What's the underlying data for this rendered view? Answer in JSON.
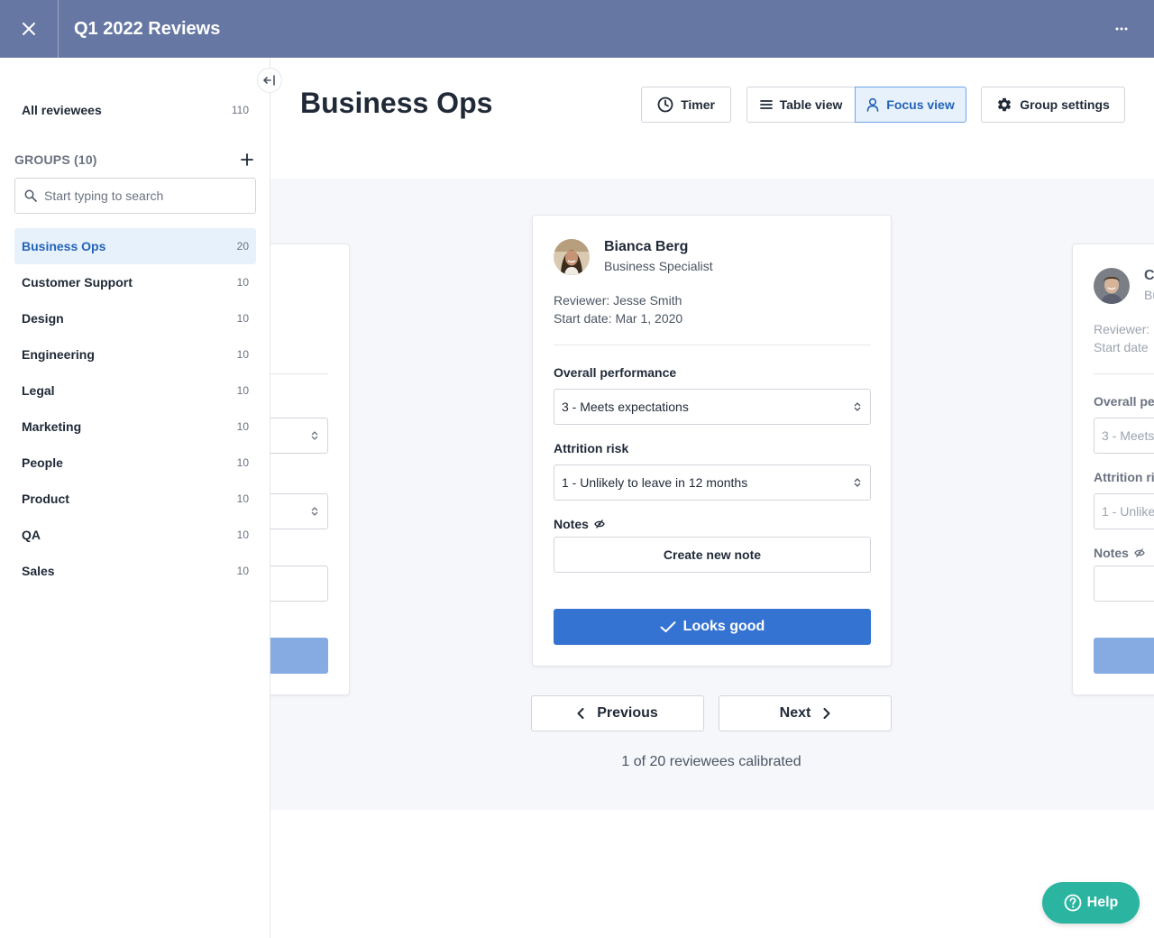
{
  "topbar": {
    "title": "Q1 2022 Reviews",
    "close_icon": "close-icon",
    "more_icon": "more-horizontal-icon"
  },
  "sidebar": {
    "all_reviewees": {
      "label": "All reviewees",
      "count": "110"
    },
    "groups_label": "GROUPS (10)",
    "search": {
      "placeholder": "Start typing to search",
      "value": ""
    },
    "groups": [
      {
        "label": "Business Ops",
        "count": "20",
        "active": true
      },
      {
        "label": "Customer Support",
        "count": "10"
      },
      {
        "label": "Design",
        "count": "10"
      },
      {
        "label": "Engineering",
        "count": "10"
      },
      {
        "label": "Legal",
        "count": "10"
      },
      {
        "label": "Marketing",
        "count": "10"
      },
      {
        "label": "People",
        "count": "10"
      },
      {
        "label": "Product",
        "count": "10"
      },
      {
        "label": "QA",
        "count": "10"
      },
      {
        "label": "Sales",
        "count": "10"
      }
    ]
  },
  "header": {
    "title": "Business Ops",
    "timer_label": "Timer",
    "table_view_label": "Table view",
    "focus_view_label": "Focus view",
    "group_settings_label": "Group settings"
  },
  "card": {
    "name": "Bianca Berg",
    "role": "Business Specialist",
    "reviewer": "Reviewer: Jesse Smith",
    "start_date": "Start date: Mar 1, 2020",
    "performance_label": "Overall performance",
    "performance_value": "3 - Meets expectations",
    "attrition_label": "Attrition risk",
    "attrition_value": "1 - Unlikely to leave in 12 months",
    "notes_label": "Notes",
    "create_note_label": "Create new note",
    "looks_good_label": "Looks good"
  },
  "right_card": {
    "name": "C",
    "role": "Bu",
    "reviewer": "Reviewer:",
    "start_date": "Start date",
    "performance_label": "Overall pe",
    "performance_value": "3 - Meets",
    "attrition_label": "Attrition ri",
    "attrition_value": "1 - Unlike",
    "notes_label": "Notes"
  },
  "nav": {
    "previous_label": "Previous",
    "next_label": "Next"
  },
  "progress": "1 of 20 reviewees calibrated",
  "help": {
    "label": "Help"
  },
  "colors": {
    "topbar": "#6677a3",
    "primary": "#3473d2",
    "active_bg": "#e6f1fb",
    "help": "#2bb5a0"
  }
}
